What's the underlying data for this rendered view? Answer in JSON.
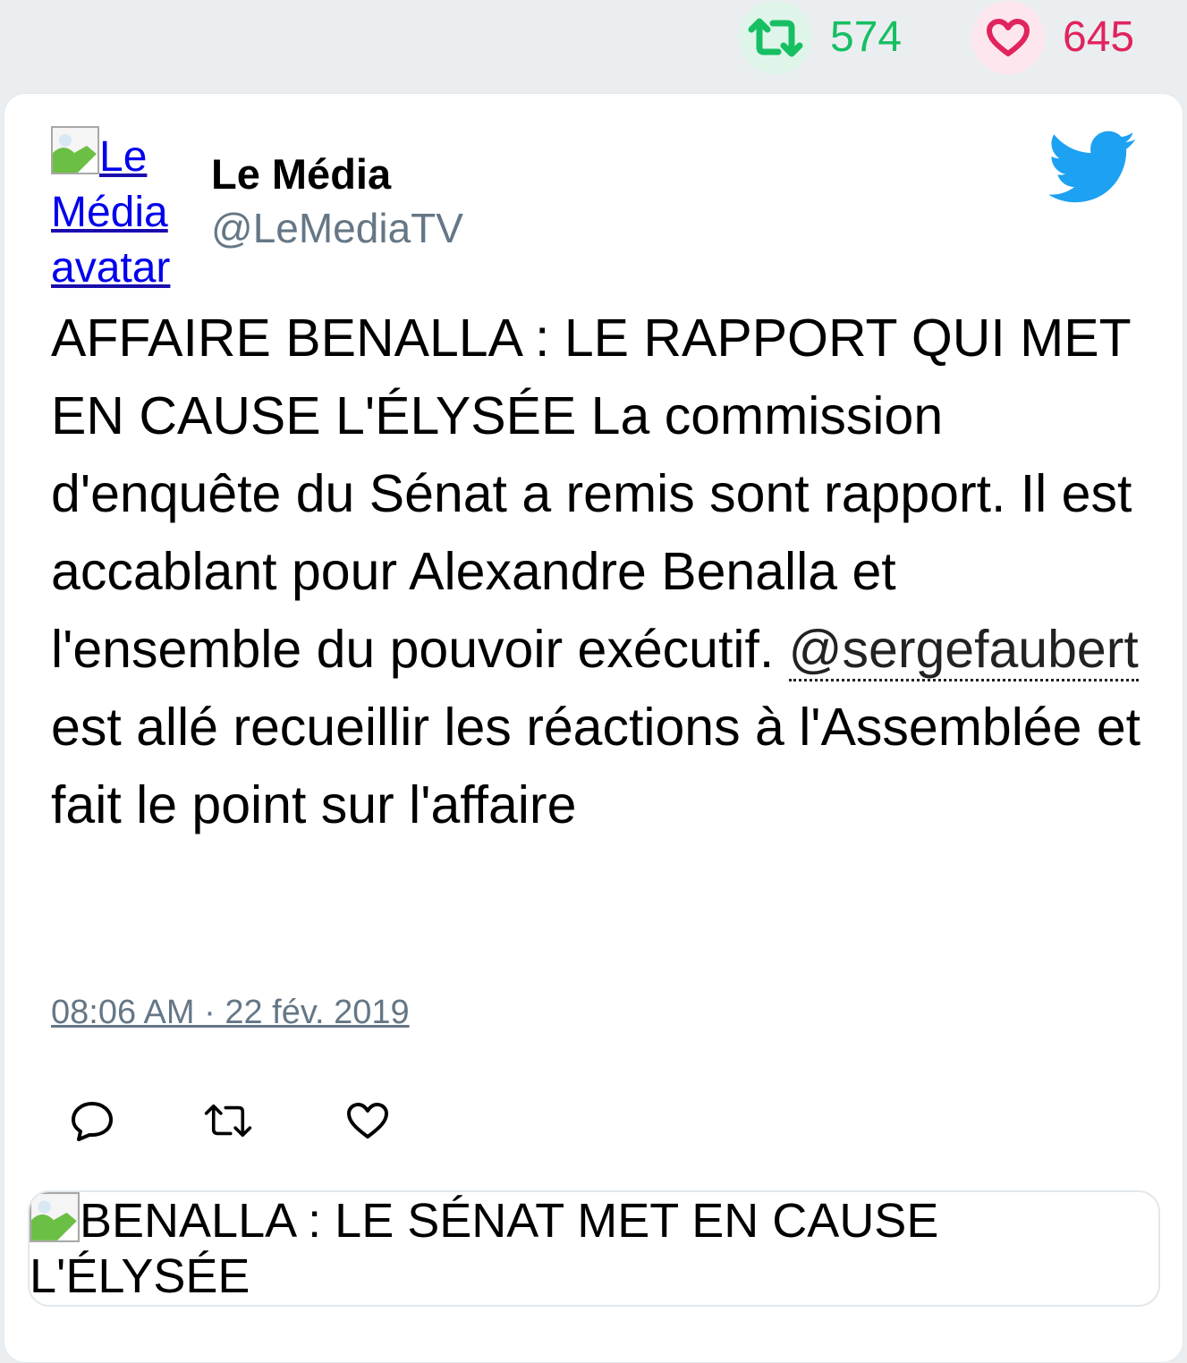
{
  "stats": {
    "retweet_icon": "retweet-icon",
    "retweet_count": "574",
    "retweet_color": "#17bf63",
    "like_icon": "heart-icon",
    "like_count": "645",
    "like_color": "#e0245e"
  },
  "tweet": {
    "avatar_alt": "Le Média avatar",
    "author_name": "Le Média",
    "author_handle": "@LeMediaTV",
    "logo_icon": "twitter-bird-icon",
    "logo_color": "#1da1f2",
    "text_before_mention": "AFFAIRE BENALLA : LE RAPPORT QUI MET EN CAUSE L'ÉLYSÉE La commission d'enquête du Sénat a remis sont rapport. Il est accablant pour Alexandre Benalla et l'ensemble du pouvoir exécutif. ",
    "mention": "@sergefaubert",
    "text_after_mention": " est allé recueillir les réactions à l'Assemblée et fait le point sur l'affaire",
    "timestamp": "08:06 AM · 22 fév. 2019",
    "actions": {
      "reply_icon": "reply-icon",
      "retweet_icon": "retweet-icon",
      "like_icon": "heart-icon"
    },
    "preview_alt": "BENALLA : LE SÉNAT MET EN CAUSE L'ÉLYSÉE"
  }
}
